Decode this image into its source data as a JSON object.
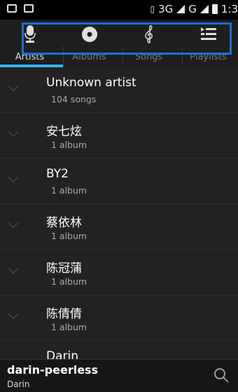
{
  "status_bar": {
    "network_label": "3G",
    "network2_label": "G",
    "time": "1:3"
  },
  "tabs": [
    {
      "label": "Artists",
      "icon": "microphone-icon",
      "active": true
    },
    {
      "label": "Albums",
      "icon": "disc-icon",
      "active": false
    },
    {
      "label": "Songs",
      "icon": "treble-clef-icon",
      "active": false
    },
    {
      "label": "Playlists",
      "icon": "playlist-icon",
      "active": false
    }
  ],
  "artists": [
    {
      "name": "Unknown artist",
      "count": "104 songs"
    },
    {
      "name": "安七炫",
      "count": "1 album"
    },
    {
      "name": "BY2",
      "count": "1 album"
    },
    {
      "name": "蔡依林",
      "count": "1 album"
    },
    {
      "name": "陈冠蒲",
      "count": "1 album"
    },
    {
      "name": "陈倩倩",
      "count": "1 album"
    },
    {
      "name": "Darin",
      "count": ""
    }
  ],
  "now_playing": {
    "title": "darin-peerless",
    "artist": "Darin"
  },
  "colors": {
    "accent": "#33b5e5",
    "highlight_box": "#1a6fd6",
    "background": "#222222"
  }
}
